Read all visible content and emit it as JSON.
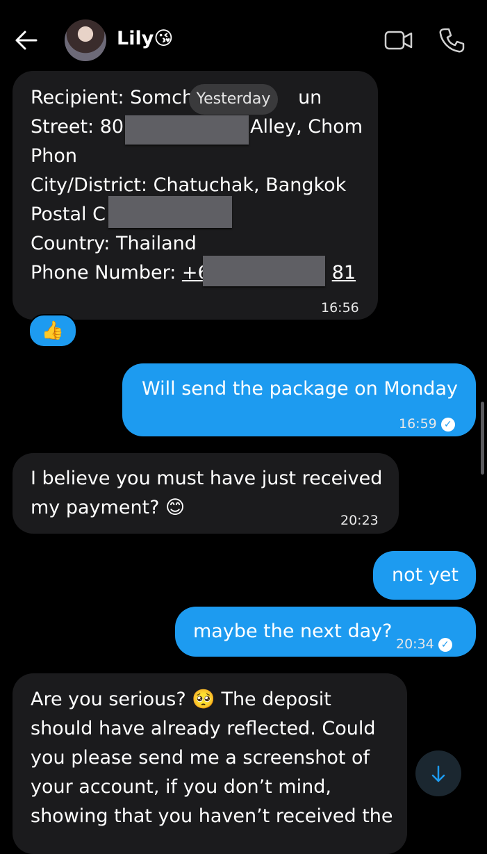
{
  "header": {
    "back_icon": "arrow-left-icon",
    "contact_name": "Lily😘",
    "video_icon": "video-camera-icon",
    "phone_icon": "phone-icon"
  },
  "date_pill": "Yesterday",
  "messages": [
    {
      "direction": "incoming",
      "lines": {
        "recipient": "Recipient: Somch",
        "recipient_tail": "un",
        "street": "Street: 80",
        "street_tail": "Alley, Chom",
        "street_line2": "Phon",
        "city": "City/District: Chatuchak, Bangkok",
        "postal": "Postal C",
        "country": "Country: Thailand",
        "phone_label": "Phone Number: ",
        "phone_start": "+6",
        "phone_end": "81"
      },
      "time": "16:56",
      "reaction": "👍"
    },
    {
      "direction": "outgoing",
      "text": "Will send the package on Monday",
      "time": "16:59",
      "read": true
    },
    {
      "direction": "incoming",
      "line1": "I believe you must have just received",
      "line2": "my payment? 😊",
      "time": "20:23"
    },
    {
      "direction": "outgoing",
      "text": "not yet"
    },
    {
      "direction": "outgoing",
      "text": "maybe the next day?",
      "time": "20:34",
      "read": true
    },
    {
      "direction": "incoming",
      "line1": "Are you serious? 🥺 The deposit",
      "line2": "should have already reflected. Could",
      "line3": "you please send me a screenshot of",
      "line4": "your account, if you don’t mind,",
      "line5": "showing that you haven’t received the"
    }
  ],
  "colors": {
    "background": "#000000",
    "incoming_bubble": "#1b1b1d",
    "outgoing_bubble": "#1d9bf0"
  },
  "scroll_down_icon": "arrow-down-icon"
}
